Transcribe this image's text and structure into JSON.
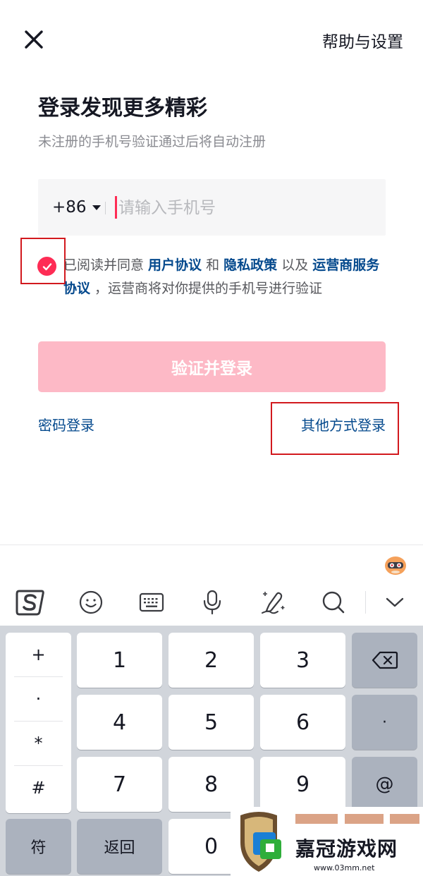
{
  "header": {
    "help_label": "帮助与设置"
  },
  "main": {
    "title": "登录发现更多精彩",
    "subtitle": "未注册的手机号验证通过后将自动注册",
    "country_code": "+86",
    "phone_placeholder": "请输入手机号",
    "agreement": {
      "prefix": "已阅读并同意 ",
      "user_agreement": "用户协议",
      "and": " 和 ",
      "privacy_policy": "隐私政策",
      "and2": " 以及 ",
      "carrier_agreement": "运营商服务协议",
      "suffix": " ，运营商将对你提供的手机号进行验证"
    },
    "login_button": "验证并登录",
    "password_login": "密码登录",
    "other_login": "其他方式登录"
  },
  "keyboard": {
    "symbols": [
      "+",
      "·",
      "*",
      "#"
    ],
    "digits": [
      "1",
      "2",
      "3",
      "4",
      "5",
      "6",
      "7",
      "8",
      "9"
    ],
    "dot_key": "·",
    "at_key": "@",
    "symbol_key": "符",
    "back_key": "返回",
    "zero_key": "0"
  },
  "watermark": {
    "name": "嘉冠游戏网",
    "url": "www.03mm.net"
  },
  "colors": {
    "accent": "#fe2c55",
    "link": "#04498d",
    "button_disabled": "#fdb9c6",
    "highlight_box": "#d2191e"
  }
}
